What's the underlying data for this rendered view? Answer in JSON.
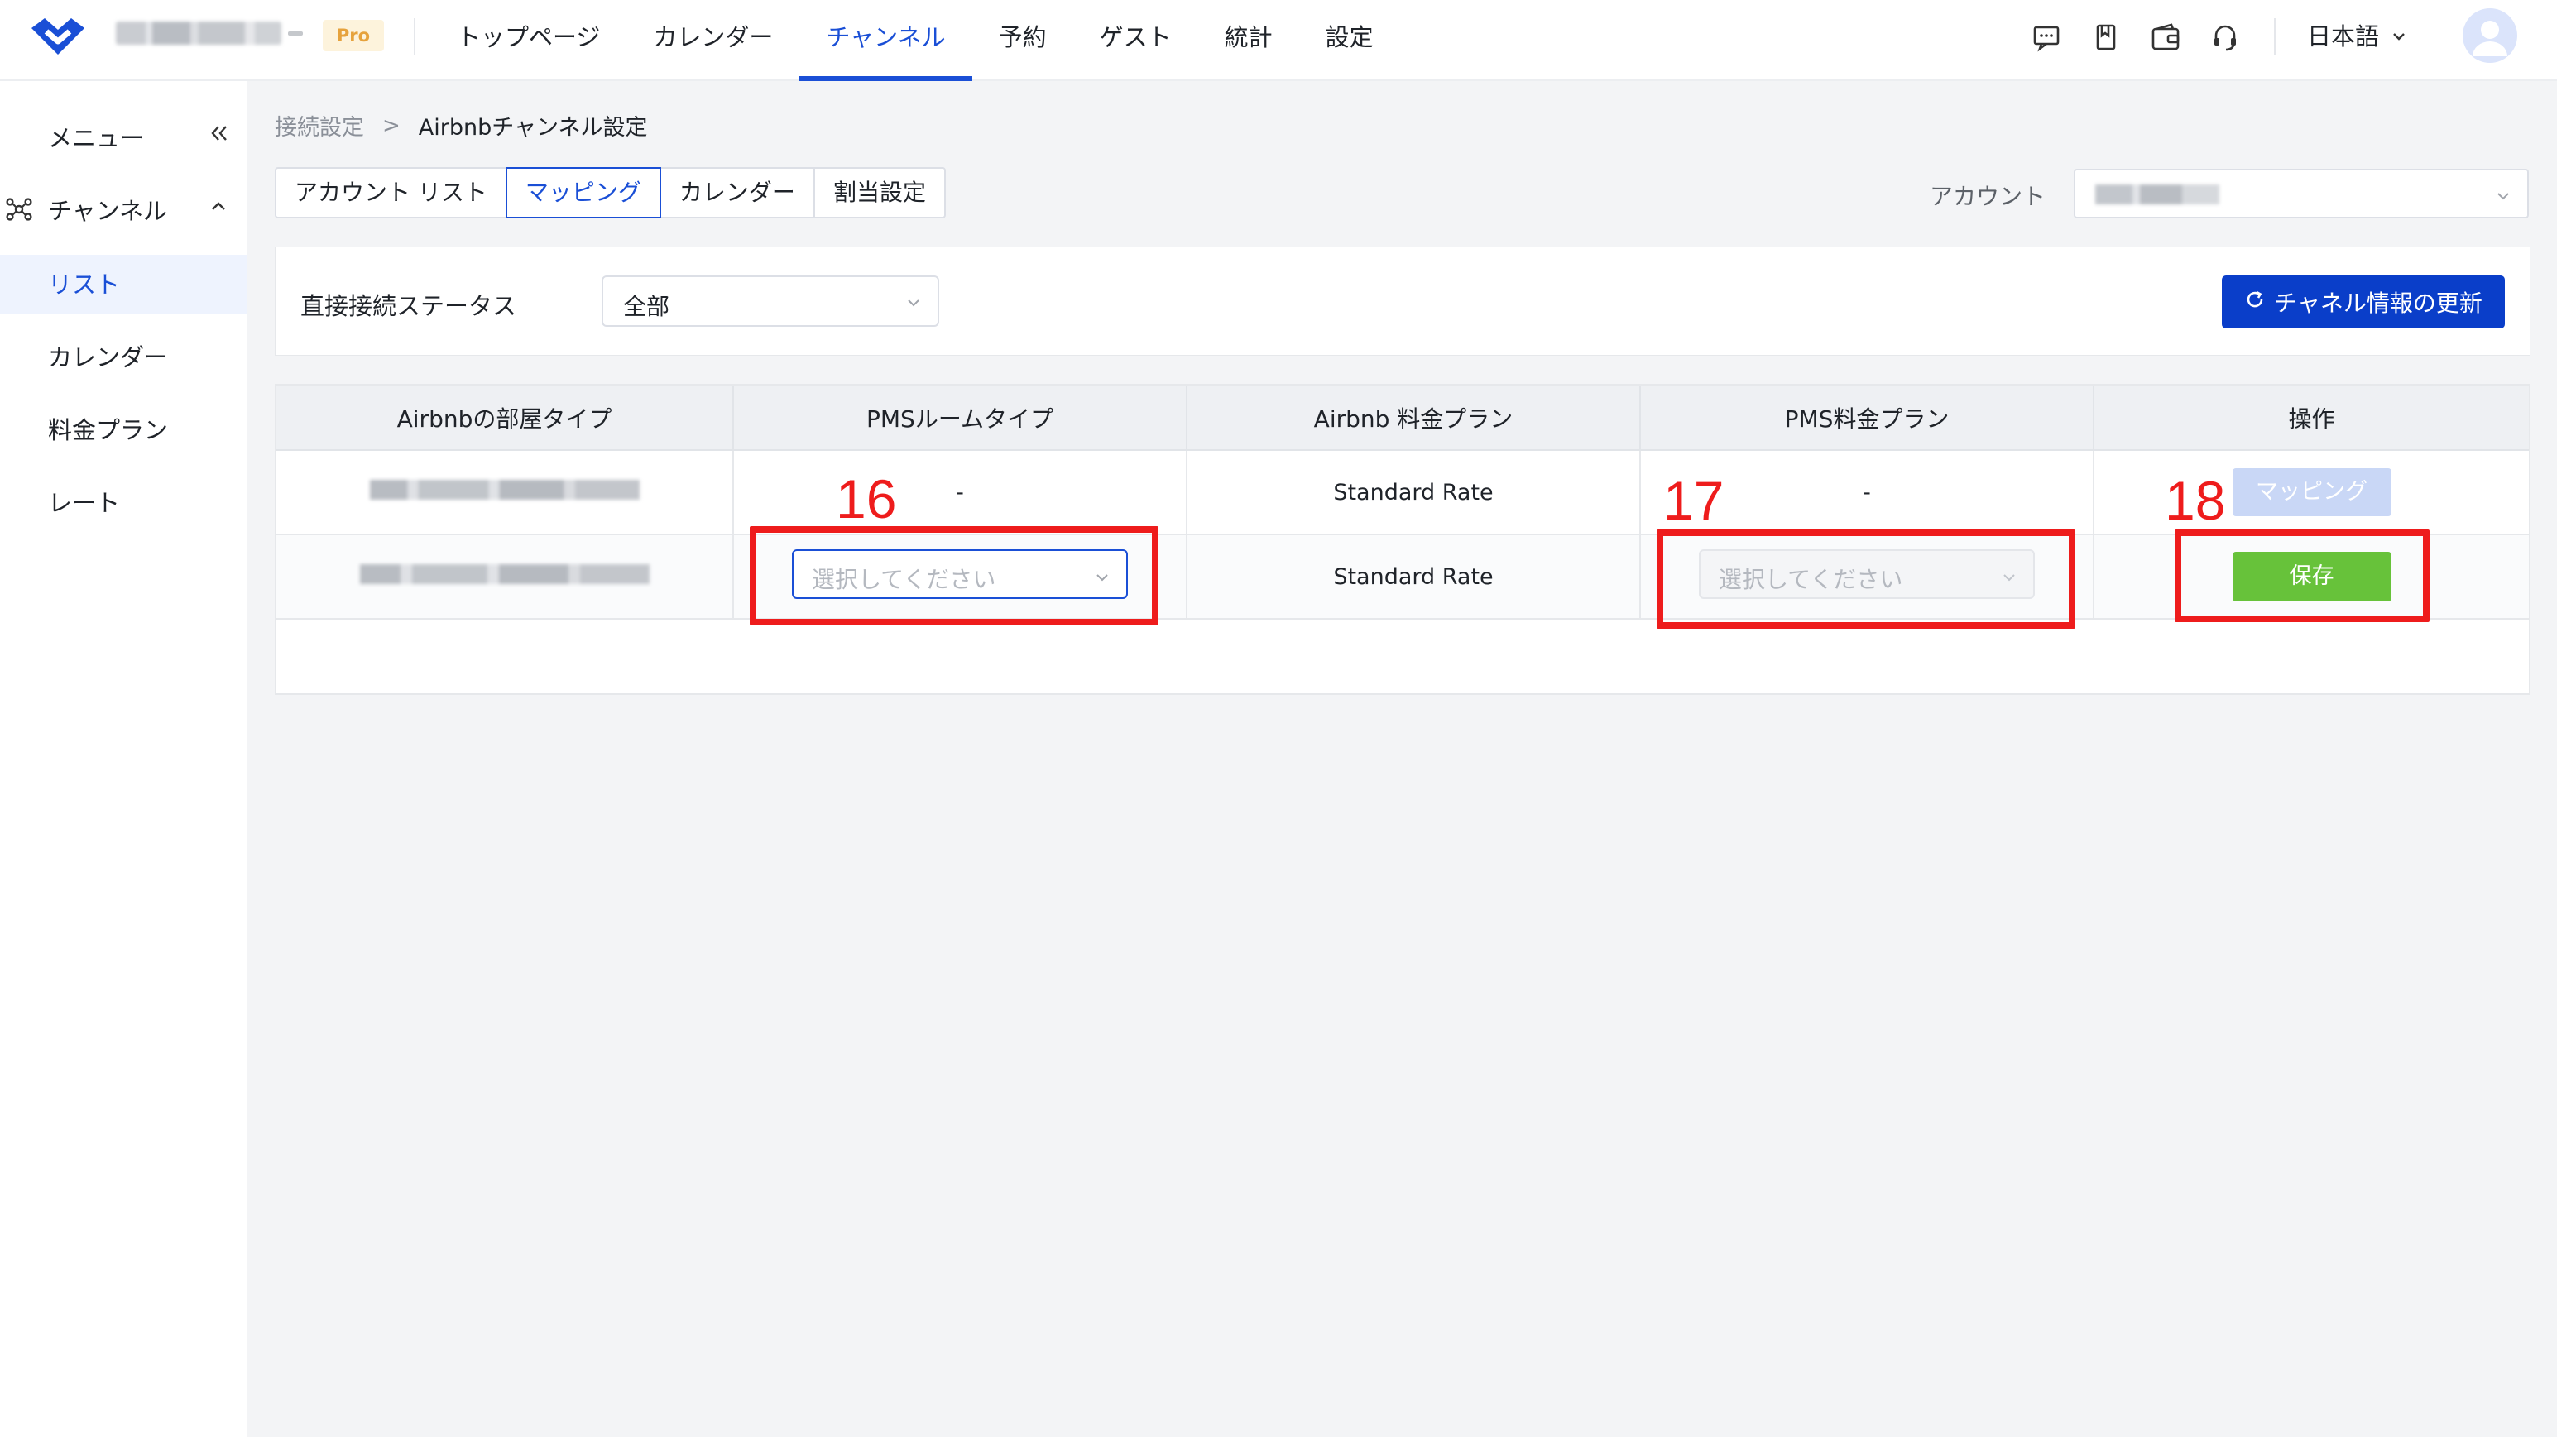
{
  "header": {
    "plan_badge": "Pro",
    "nav": [
      {
        "label": "トップページ",
        "active": false
      },
      {
        "label": "カレンダー",
        "active": false
      },
      {
        "label": "チャンネル",
        "active": true
      },
      {
        "label": "予約",
        "active": false
      },
      {
        "label": "ゲスト",
        "active": false
      },
      {
        "label": "統計",
        "active": false
      },
      {
        "label": "設定",
        "active": false
      }
    ],
    "icons": [
      "chat-icon",
      "bookmark-icon",
      "wallet-icon",
      "headset-icon"
    ],
    "language": "日本語",
    "accent_color": "#1a4fd6"
  },
  "sidebar": {
    "menu_label": "メニュー",
    "group_label": "チャンネル",
    "items": [
      {
        "label": "リスト",
        "active": true
      },
      {
        "label": "カレンダー",
        "active": false
      },
      {
        "label": "料金プラン",
        "active": false
      },
      {
        "label": "レート",
        "active": false
      }
    ]
  },
  "breadcrumb": {
    "parent": "接続設定",
    "separator": ">",
    "current": "Airbnbチャンネル設定"
  },
  "tabs": [
    {
      "label": "アカウント リスト",
      "active": false
    },
    {
      "label": "マッピング",
      "active": true
    },
    {
      "label": "カレンダー",
      "active": false
    },
    {
      "label": "割当設定",
      "active": false
    }
  ],
  "account": {
    "label": "アカウント"
  },
  "filter": {
    "label": "直接接続ステータス",
    "value": "全部",
    "refresh_button": "チャネル情報の更新",
    "refresh_color": "#0a3ec9"
  },
  "table": {
    "columns": [
      "Airbnbの部屋タイプ",
      "PMSルームタイプ",
      "Airbnb 料金プラン",
      "PMS料金プラン",
      "操作"
    ],
    "rows": [
      {
        "pms_room": "-",
        "airbnb_plan": "Standard Rate",
        "pms_plan": "-",
        "action": "マッピング"
      },
      {
        "pms_room_placeholder": "選択してください",
        "airbnb_plan": "Standard Rate",
        "pms_plan_placeholder": "選択してください",
        "action": "保存",
        "action_color": "#67c23a"
      }
    ]
  },
  "annotations": {
    "color": "#ee1c1c",
    "labels": [
      "16",
      "17",
      "18"
    ]
  }
}
